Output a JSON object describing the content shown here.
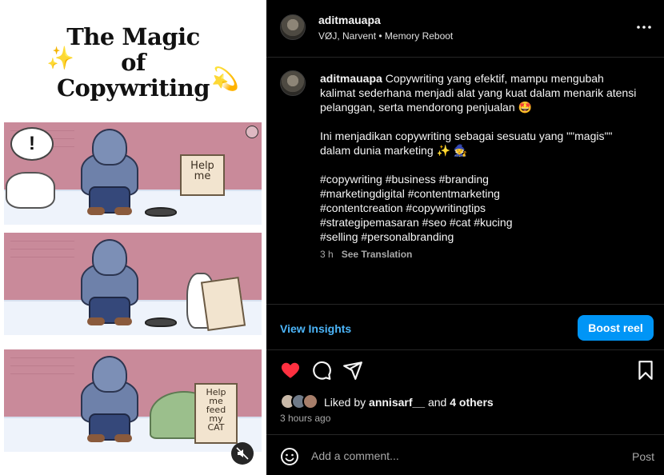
{
  "media": {
    "title_lines": [
      "The Magic",
      "of",
      "Copywriting"
    ],
    "sign_1": "Help\nme",
    "sign_3": "Help\nme\nfeed\nmy\nCAT"
  },
  "post": {
    "username": "aditmauapa",
    "subtitle": "VØJ, Narvent • Memory Reboot",
    "caption_line1": "Copywriting yang efektif, mampu mengubah kalimat sederhana menjadi alat yang kuat dalam menarik atensi pelanggan, serta mendorong penjualan 🤩",
    "caption_line2": "Ini menjadikan copywriting sebagai sesuatu yang \"\"magis\"\" dalam dunia marketing ✨ 🧙",
    "hashtags": [
      "#copywriting #business #branding",
      "#marketingdigital #contentmarketing",
      "#contentcreation #copywritingtips",
      "#strategipemasaran #seo #cat #kucing",
      "#selling #personalbranding"
    ],
    "time_ago": "3 h",
    "see_translation": "See Translation"
  },
  "insights": {
    "view_label": "View Insights",
    "boost_label": "Boost reel"
  },
  "likes": {
    "prefix": "Liked by ",
    "user": "annisarf__",
    "middle": " and ",
    "others": "4 others"
  },
  "timestamp": "3 hours ago",
  "comment": {
    "placeholder": "Add a comment...",
    "post_label": "Post"
  },
  "colors": {
    "accent": "#0095f6",
    "link": "#4cb5f9",
    "like": "#ff3040"
  }
}
